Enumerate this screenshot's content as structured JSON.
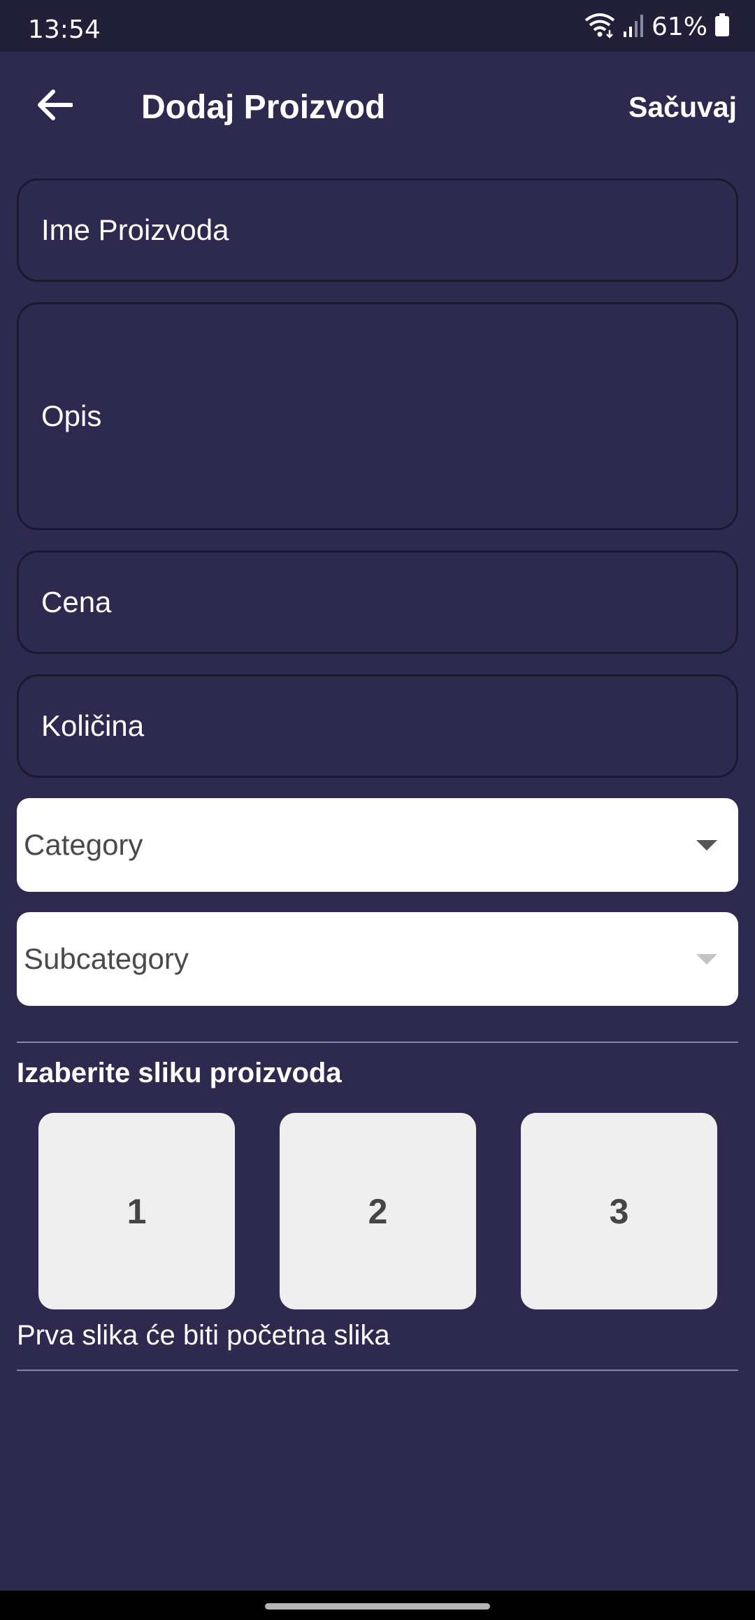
{
  "status_bar": {
    "time": "13:54",
    "battery": "61%",
    "icons": [
      "wifi-icon",
      "signal-icon",
      "battery-icon"
    ]
  },
  "app_bar": {
    "back_icon": "arrow-left-icon",
    "title": "Dodaj Proizvod",
    "save_label": "Sačuvaj"
  },
  "form": {
    "name_placeholder": "Ime Proizvoda",
    "description_placeholder": "Opis",
    "price_placeholder": "Cena",
    "quantity_placeholder": "Količina",
    "category_placeholder": "Category",
    "subcategory_placeholder": "Subcategory"
  },
  "images": {
    "section_title": "Izaberite sliku proizvoda",
    "slots": [
      "1",
      "2",
      "3"
    ],
    "hint": "Prva slika će biti početna slika"
  },
  "colors": {
    "background": "#2e2a4f",
    "status_bar": "#222038",
    "field_border": "#1b1930",
    "dropdown_background": "#ffffff",
    "image_slot_background": "#efefef"
  }
}
